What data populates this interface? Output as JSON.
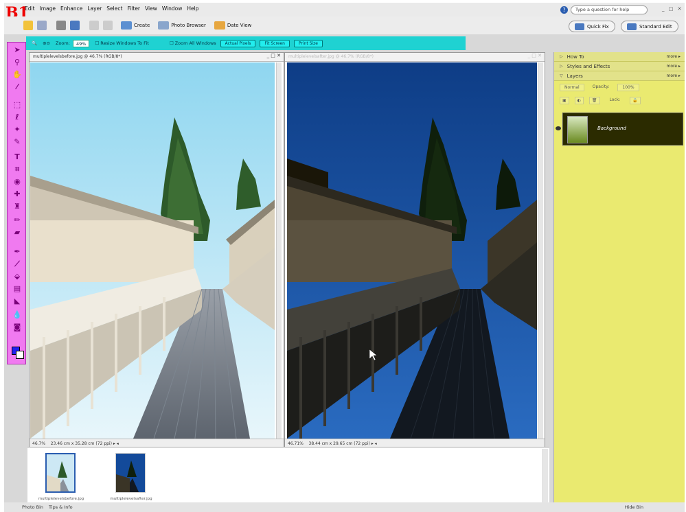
{
  "app": {
    "logo": "B1"
  },
  "menu": [
    "Edit",
    "Image",
    "Enhance",
    "Layer",
    "Select",
    "Filter",
    "View",
    "Window",
    "Help"
  ],
  "help": {
    "placeholder": "Type a question for help"
  },
  "toolbar": {
    "buttons": [
      {
        "label": "Create"
      },
      {
        "label": "Photo Browser"
      },
      {
        "label": "Date View"
      }
    ],
    "modes": [
      {
        "label": "Quick Fix"
      },
      {
        "label": "Standard Edit"
      }
    ]
  },
  "options": {
    "zoom_label": "Zoom:",
    "zoom_value": "49%",
    "resize_windows": "Resize Windows To Fit",
    "zoom_all_windows": "Zoom All Windows",
    "buttons": [
      "Actual Pixels",
      "Fit Screen",
      "Print Size"
    ]
  },
  "windows": [
    {
      "title": "multiplelevelsbefore.jpg @ 46.7% (RGB/8*)",
      "zoom": "46.7%",
      "size": "23.46 cm x 35.28 cm (72 ppi)",
      "controls": "_ □ ✕"
    },
    {
      "title": "multiplelevelsafter.jpg @ 46.7% (RGB/8*)",
      "zoom": "46.71%",
      "size": "38.44 cm x 29.65 cm (72 ppi)",
      "controls": "_ □ ✕"
    }
  ],
  "photo_bin": {
    "thumbs": [
      {
        "caption": "multiplelevelsbefore.jpg"
      },
      {
        "caption": "multiplelevelsafter.jpg"
      }
    ]
  },
  "palette": {
    "sections": [
      {
        "label": "How To",
        "more": "more ▸"
      },
      {
        "label": "Styles and Effects",
        "more": "more ▸"
      },
      {
        "label": "Layers",
        "more": "more ▸"
      }
    ],
    "layer_mode": "Normal",
    "layer_opacity": "Opacity:",
    "opacity_value": "100%",
    "lock": "Lock:",
    "layer_name": "Background"
  },
  "bottom": {
    "photo_bin": "Photo Bin",
    "tips": "Tips & Info",
    "status": "Hide Bin"
  },
  "colors": {
    "toolbox": "#f07af0",
    "options_bar": "#1fd2d2",
    "palette": "#eaea70"
  }
}
